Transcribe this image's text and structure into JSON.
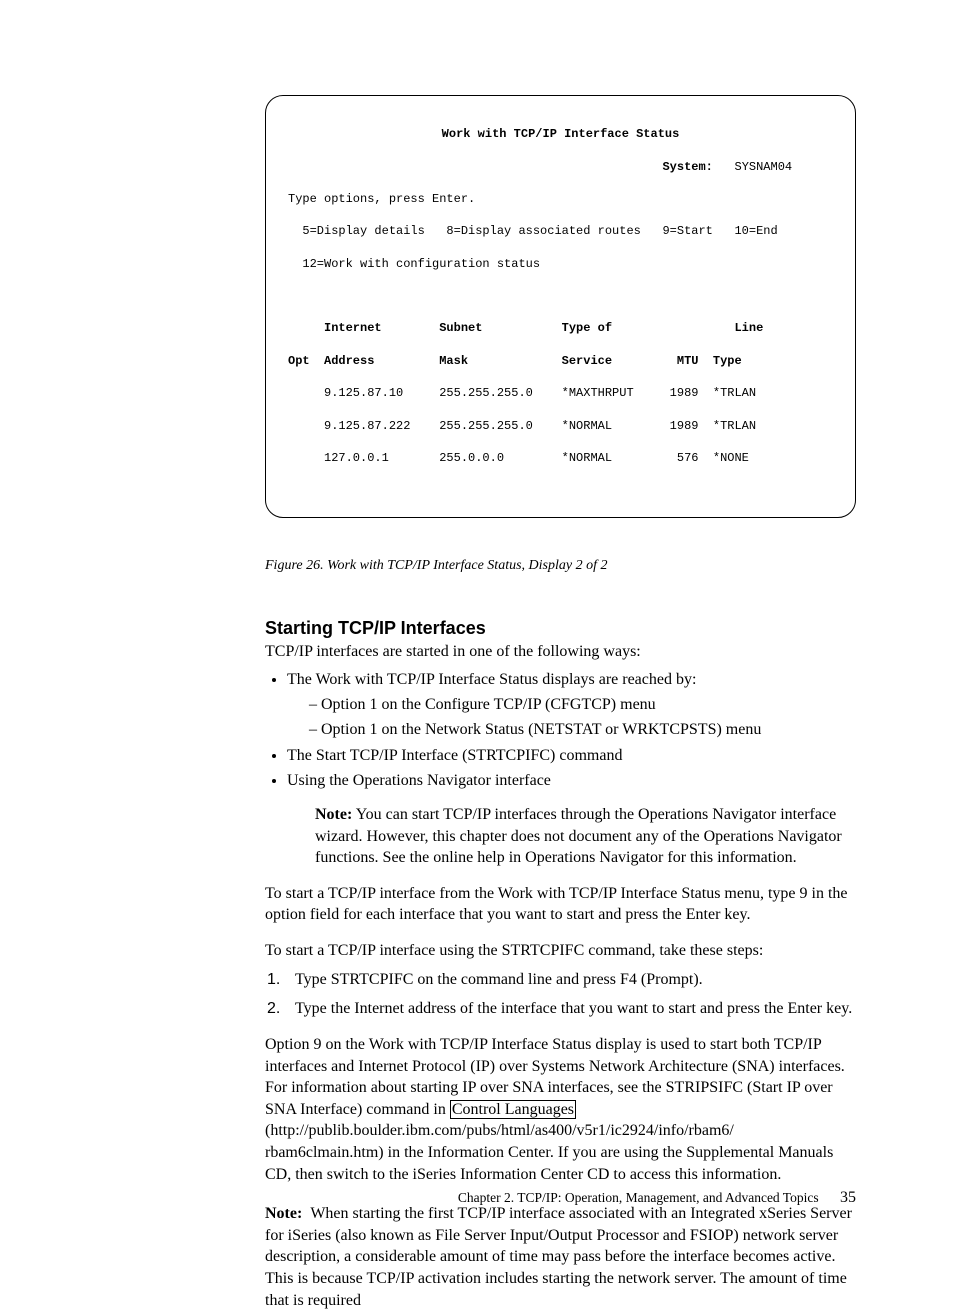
{
  "terminal": {
    "title": "Work with TCP/IP Interface Status",
    "system_label": "System:",
    "system_value": "SYSNAM04",
    "instr1": "Type options, press Enter.",
    "instr2": "  5=Display details   8=Display associated routes   9=Start   10=End",
    "instr3": "  12=Work with configuration status",
    "hdr1": "     Internet        Subnet           Type of                 Line",
    "hdr2": "Opt  Address         Mask             Service         MTU  Type",
    "row1": "     9.125.87.10     255.255.255.0    *MAXTHRPUT     1989  *TRLAN",
    "row2": "     9.125.87.222    255.255.255.0    *NORMAL        1989  *TRLAN",
    "row3": "     127.0.0.1       255.0.0.0        *NORMAL         576  *NONE"
  },
  "figure_caption": "Figure 26. Work with TCP/IP Interface Status, Display 2 of 2",
  "section": {
    "title": "Starting TCP/IP Interfaces",
    "intro": "TCP/IP interfaces are started in one of the following ways:",
    "bullets": {
      "b1": "The Work with TCP/IP Interface Status displays are reached by:",
      "b1a": "Option 1 on the Configure TCP/IP (CFGTCP) menu",
      "b1b": "Option 1 on the Network Status (NETSTAT or WRKTCPSTS) menu",
      "b2": "The Start TCP/IP Interface (STRTCPIFC) command",
      "b3": "Using the Operations Navigator interface"
    },
    "note1_label": "Note:",
    "note1_text": "You can start TCP/IP interfaces through the Operations Navigator interface wizard. However, this chapter does not document any of the Operations Navigator functions. See the online help in Operations Navigator for this information.",
    "para1": "To start a TCP/IP interface from the Work with TCP/IP Interface Status menu, type 9 in the option field for each interface that you want to start and press the Enter key.",
    "para2": "To start a TCP/IP interface using the STRTCPIFC command, take these steps:",
    "step1": "Type STRTCPIFC on the command line and press F4 (Prompt).",
    "step2": "Type the Internet address of the interface that you want to start and press the Enter key.",
    "para3a": "Option 9 on the Work with TCP/IP Interface Status display is used to start both TCP/IP interfaces and Internet Protocol (IP) over Systems Network Architecture (SNA) interfaces. For information about starting IP over SNA interfaces, see the STRIPSIFC (Start IP over SNA Interface) command in ",
    "para3_link": "Control Languages",
    "para3b": " (http://publib.boulder.ibm.com/pubs/html/as400/v5r1/ic2924/info/rbam6/ rbam6clmain.htm) in the Information Center. If you are using the Supplemental Manuals CD, then switch to the iSeries Information Center CD to access this information.",
    "note2_label": "Note:",
    "note2_text": "When starting the first TCP/IP interface associated with an Integrated xSeries Server for iSeries (also known as File Server Input/Output Processor and FSIOP) network server description, a considerable amount of time may pass before the interface becomes active. This is because TCP/IP activation includes starting the network server. The amount of time that is required"
  },
  "footer": {
    "chapter": "Chapter 2. TCP/IP: Operation, Management, and Advanced Topics",
    "page": "35"
  }
}
